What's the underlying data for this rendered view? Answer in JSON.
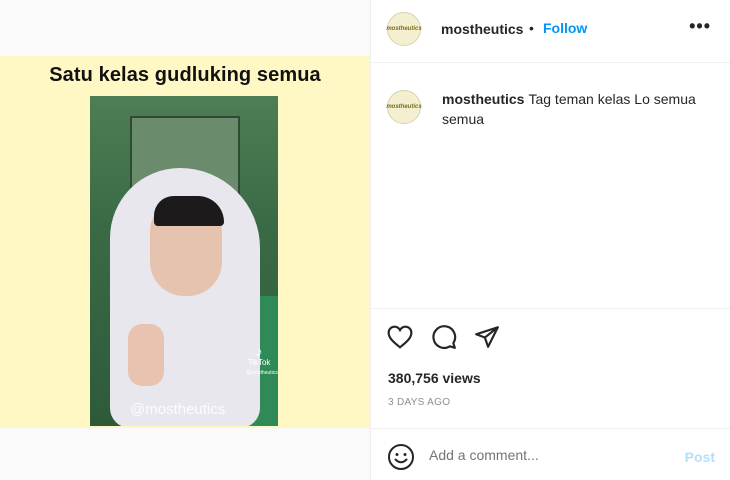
{
  "media": {
    "title": "Satu kelas gudluking semua",
    "watermark": "@mostheutics",
    "tiktok_label": "TikTok",
    "tiktok_handle": "@mostheutics"
  },
  "header": {
    "username": "mostheutics",
    "separator": "•",
    "follow_label": "Follow",
    "more_label": "•••",
    "avatar_text": "mostheutics"
  },
  "caption": {
    "username": "mostheutics",
    "text": "Tag teman kelas Lo semua semua"
  },
  "stats": {
    "views": "380,756 views",
    "date": "3 DAYS AGO"
  },
  "comment": {
    "placeholder": "Add a comment...",
    "post_label": "Post"
  },
  "icons": [
    "heart-icon",
    "comment-icon",
    "share-icon",
    "emoji-icon",
    "more-icon",
    "tiktok-icon"
  ],
  "colors": {
    "accent": "#0095f6",
    "post_disabled": "#b2dffc",
    "media_background": "#fff8c5",
    "text": "#262626",
    "muted": "#8e8e8e"
  }
}
